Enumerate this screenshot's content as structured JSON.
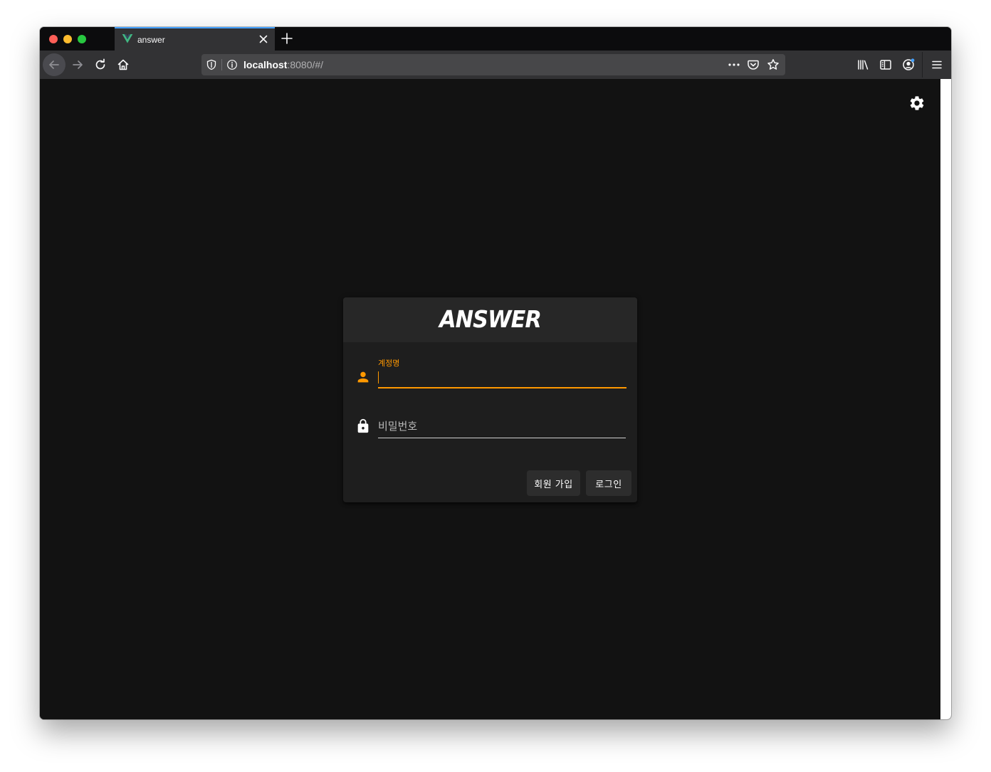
{
  "browser": {
    "tab": {
      "title": "answer",
      "favicon": "vue-logo-icon"
    },
    "url": {
      "host": "localhost",
      "rest": ":8080/#/"
    }
  },
  "app": {
    "logo": "ANSWER",
    "form": {
      "username": {
        "label": "계정명",
        "value": ""
      },
      "password": {
        "placeholder": "비밀번호",
        "value": ""
      }
    },
    "buttons": {
      "signup": "회원 가입",
      "login": "로그인"
    }
  },
  "colors": {
    "accent": "#ff9800",
    "background": "#121212",
    "card": "#1e1e1e"
  }
}
